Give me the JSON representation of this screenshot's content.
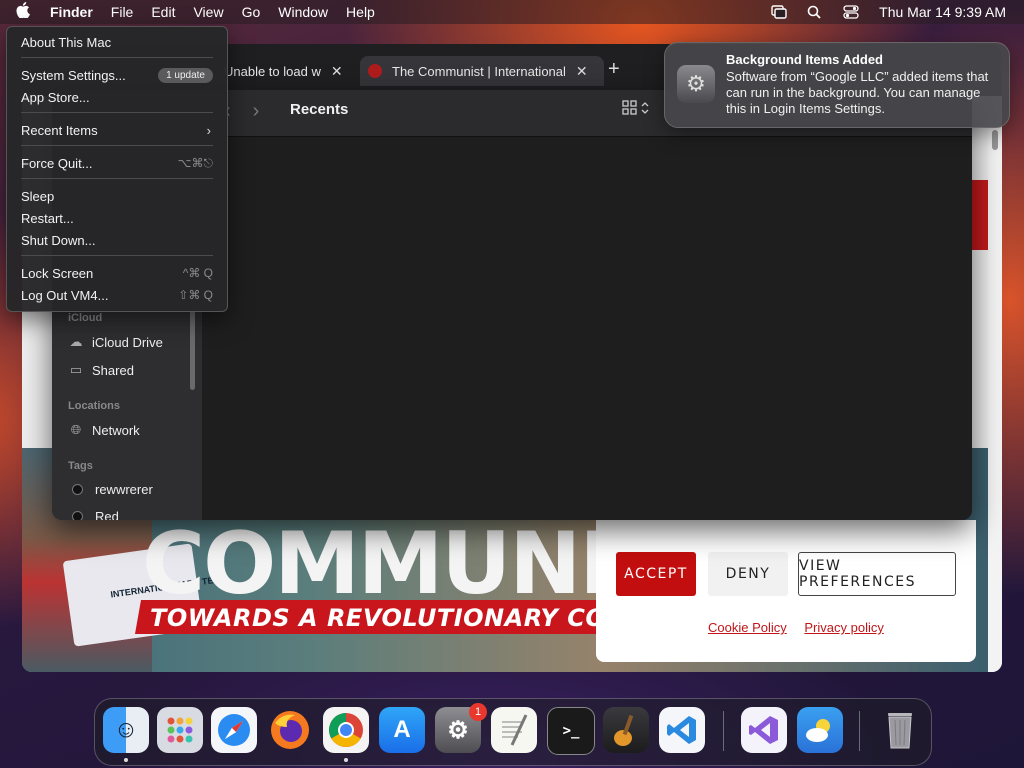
{
  "menubar": {
    "app_name": "Finder",
    "items": [
      "File",
      "Edit",
      "View",
      "Go",
      "Window",
      "Help"
    ],
    "clock": "Thu Mar 14  9:39 AM",
    "status_icons": [
      "screen-mirroring-icon",
      "spotlight-search-icon",
      "control-center-icon"
    ]
  },
  "apple_menu": {
    "about": "About This Mac",
    "system_settings": "System Settings...",
    "update_badge": "1 update",
    "app_store": "App Store...",
    "recent_items": "Recent Items",
    "force_quit": "Force Quit...",
    "force_quit_shortcut": "⌥⌘⎋",
    "sleep": "Sleep",
    "restart": "Restart...",
    "shut_down": "Shut Down...",
    "lock_screen": "Lock Screen",
    "lock_screen_shortcut": "^⌘ Q",
    "log_out": "Log Out VM4...",
    "log_out_shortcut": "⇧⌘ Q"
  },
  "browser": {
    "tabs": [
      {
        "title": "Unable to load w",
        "active": false
      },
      {
        "title": "The Communist | International",
        "active": true
      }
    ],
    "poster": {
      "big_word": "COMMUNI",
      "banner": "TOWARDS A REVOLUTIONARY COMMUNIST",
      "flag_text": "INTERNATION MARX TEN"
    },
    "cookie": {
      "fade_text": "...",
      "accept": "ACCEPT",
      "deny": "DENY",
      "preferences": "VIEW PREFERENCES",
      "cookie_policy": "Cookie Policy",
      "privacy_policy": "Privacy policy"
    }
  },
  "finder": {
    "title": "Recents",
    "sidebar": {
      "icloud_header": "iCloud",
      "icloud_drive": "iCloud Drive",
      "shared": "Shared",
      "locations_header": "Locations",
      "network": "Network",
      "tags_header": "Tags",
      "tags": [
        "rewwrerer",
        "Red"
      ]
    }
  },
  "notification": {
    "title": "Background Items Added",
    "body": "Software from “Google LLC” added items that can run in the background. You can manage this in Login Items Settings."
  },
  "dock": {
    "apps": [
      "Finder",
      "Launchpad",
      "Safari",
      "Firefox",
      "Chrome",
      "App Store",
      "System Settings",
      "TextEdit",
      "Terminal",
      "GarageBand",
      "Visual Studio Code",
      "Visual Studio",
      "Weather",
      "Trash"
    ],
    "settings_badge": "1"
  },
  "colors": {
    "accent_red": "#c20e0e",
    "menu_bg": "#262628",
    "notif_bg": "#48484c"
  }
}
